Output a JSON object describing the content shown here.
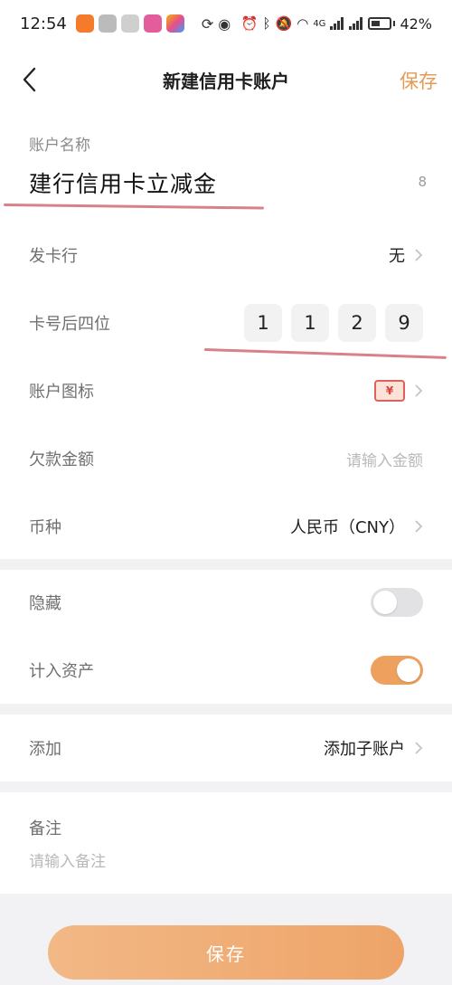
{
  "status_bar": {
    "time": "12:54",
    "network": "4G",
    "battery": "42%"
  },
  "header": {
    "title": "新建信用卡账户",
    "save_label": "保存"
  },
  "account_name": {
    "label": "账户名称",
    "value": "建行信用卡立减金",
    "char_count": "8"
  },
  "issuer": {
    "label": "发卡行",
    "value": "无"
  },
  "card_last4": {
    "label": "卡号后四位",
    "digits": [
      "1",
      "1",
      "2",
      "9"
    ]
  },
  "account_icon": {
    "label": "账户图标",
    "icon": "card-yuan-icon",
    "glyph": "¥"
  },
  "debt": {
    "label": "欠款金额",
    "placeholder": "请输入金额"
  },
  "currency": {
    "label": "币种",
    "value": "人民币（CNY）"
  },
  "hidden": {
    "label": "隐藏",
    "on": false
  },
  "count_in_assets": {
    "label": "计入资产",
    "on": true
  },
  "add": {
    "label": "添加",
    "value": "添加子账户"
  },
  "note": {
    "label": "备注",
    "placeholder": "请输入备注"
  },
  "save_button": {
    "label": "保存"
  },
  "colors": {
    "accent": "#eea15e",
    "annotation_line": "#d9818a"
  }
}
